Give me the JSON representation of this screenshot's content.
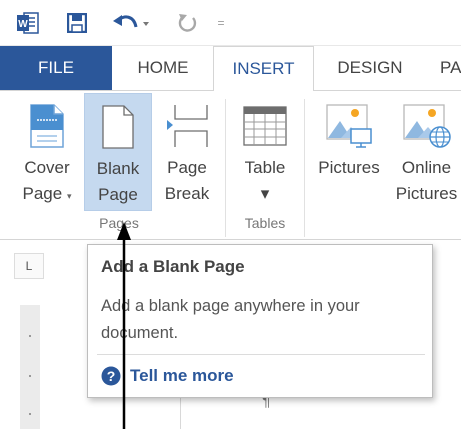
{
  "quick_access": {
    "icons": [
      "word-app-icon",
      "save-icon",
      "undo-icon",
      "redo-icon",
      "customize-qat-icon"
    ],
    "customize_glyph": "="
  },
  "tabs": [
    {
      "label": "FILE",
      "active": false
    },
    {
      "label": "HOME",
      "active": false
    },
    {
      "label": "INSERT",
      "active": true
    },
    {
      "label": "DESIGN",
      "active": false
    },
    {
      "label": "PA",
      "active": false
    }
  ],
  "ribbon": {
    "cover_page": {
      "line1": "Cover",
      "line2": "Page",
      "dropdown": "▾",
      "icon": "cover-page-icon"
    },
    "blank_page": {
      "line1": "Blank",
      "line2": "Page",
      "icon": "blank-page-icon"
    },
    "page_break": {
      "line1": "Page",
      "line2": "Break",
      "icon": "page-break-icon"
    },
    "table": {
      "line1": "Table",
      "dropdown": "▾",
      "icon": "table-icon"
    },
    "pictures": {
      "line1": "Pictures",
      "icon": "pictures-icon"
    },
    "online_pictures": {
      "line1": "Online",
      "line2": "Pictures",
      "icon": "online-pictures-icon"
    },
    "groups": {
      "pages": "Pages",
      "tables": "Tables"
    }
  },
  "document": {
    "ruler_tab": "L",
    "paragraph_mark": "¶"
  },
  "tooltip": {
    "title": "Add a Blank Page",
    "description": "Add a blank page anywhere in your document.",
    "help_link": "Tell me more",
    "help_icon": "help-icon"
  },
  "colors": {
    "word_blue": "#2b579a",
    "active_button": "#c5d9ef",
    "icon_blue": "#4a8fd0"
  }
}
